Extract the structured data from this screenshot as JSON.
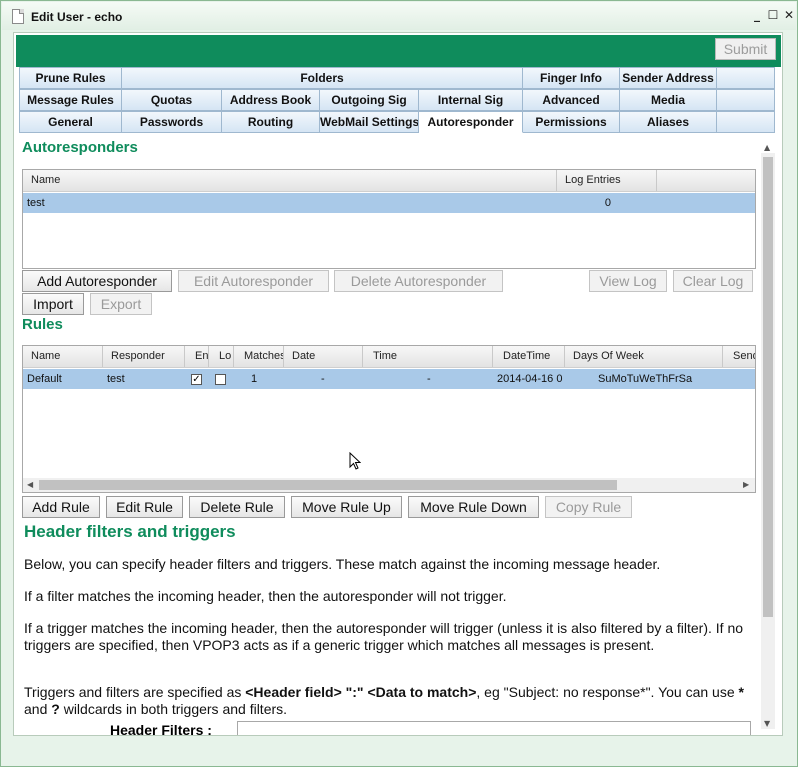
{
  "window": {
    "title": "Edit User - echo"
  },
  "toolbar": {
    "submit_label": "Submit"
  },
  "tabs": {
    "row1": [
      "Prune Rules",
      "Folders",
      "Finger Info",
      "Sender Address"
    ],
    "row2": [
      "Message Rules",
      "Quotas",
      "Address Book",
      "Outgoing Sig",
      "Internal Sig",
      "Advanced",
      "Media"
    ],
    "row3": [
      "General",
      "Passwords",
      "Routing",
      "WebMail Settings",
      "Autoresponder",
      "Permissions",
      "Aliases"
    ]
  },
  "autoresponders": {
    "title": "Autoresponders",
    "columns": [
      "Name",
      "Log Entries"
    ],
    "rows": [
      {
        "name": "test",
        "log_entries": "0"
      }
    ],
    "buttons": {
      "add": "Add Autoresponder",
      "edit": "Edit Autoresponder",
      "delete": "Delete Autoresponder",
      "view_log": "View Log",
      "clear_log": "Clear Log",
      "import": "Import",
      "export": "Export"
    }
  },
  "rules": {
    "title": "Rules",
    "columns": [
      "Name",
      "Responder",
      "En",
      "Lo",
      "Matches",
      "Date",
      "Time",
      "DateTime",
      "Days Of Week",
      "Send"
    ],
    "rows": [
      {
        "name": "Default",
        "responder": "test",
        "enabled": true,
        "log": false,
        "matches": "1",
        "date": "-",
        "time": "-",
        "datetime": "2014-04-16 0",
        "days_of_week": "SuMoTuWeThFrSa"
      }
    ],
    "buttons": {
      "add": "Add Rule",
      "edit": "Edit Rule",
      "delete": "Delete Rule",
      "move_up": "Move Rule Up",
      "move_down": "Move Rule Down",
      "copy": "Copy Rule"
    }
  },
  "header_filters": {
    "title": "Header filters and triggers",
    "p1": "Below, you can specify header filters and triggers. These match against the incoming message header.",
    "p2": "If a filter matches the incoming header, then the autoresponder will not trigger.",
    "p3": "If a trigger matches the incoming header, then the autoresponder will trigger (unless it is also filtered by a filter). If no triggers are specified, then VPOP3 acts as if a generic trigger which matches all messages is present.",
    "p4_a": "Triggers and filters are specified as ",
    "p4_b": "<Header field> \":\" <Data to match>",
    "p4_c": ", eg \"Subject: no response*\". You can use ",
    "p4_d": "*",
    "p4_e": " and ",
    "p4_f": "?",
    "p4_g": " wildcards in both triggers and filters.",
    "filters_label": "Header Filters :",
    "filters_value": ""
  }
}
